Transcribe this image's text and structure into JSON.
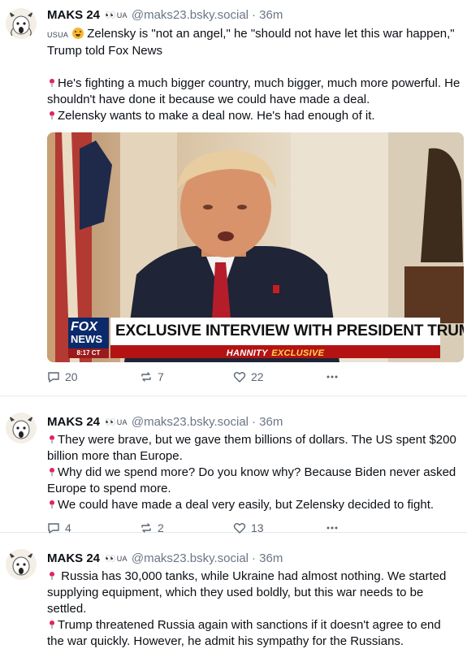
{
  "posts": [
    {
      "author": {
        "name": "MAKS 24",
        "flag_code": "UA",
        "handle": "@maks23.bsky.social",
        "time": "· 36m"
      },
      "lines": [
        {
          "prefix_code": "USUA",
          "emoji": "😳",
          "text": "Zelensky is \"not an angel,\" he \"should not have let this war happen,\" Trump told Fox News"
        },
        {
          "text": ""
        },
        {
          "pin": true,
          "text": "He's fighting a much bigger country, much bigger, much more powerful. He shouldn't have done it because we could have made a deal."
        },
        {
          "pin": true,
          "text": "Zelensky wants to make a deal now. He's had enough of it."
        }
      ],
      "media": {
        "banner": "EXCLUSIVE INTERVIEW WITH PRESIDENT TRUMP",
        "subtitle": "HANNITY",
        "subtitle_highlight": "EXCLUSIVE",
        "logo_top": "FOX",
        "logo_bottom": "NEWS",
        "logo_time": "8:17 CT"
      },
      "stats": {
        "replies": "20",
        "reposts": "7",
        "likes": "22"
      }
    },
    {
      "author": {
        "name": "MAKS 24",
        "flag_code": "UA",
        "handle": "@maks23.bsky.social",
        "time": "· 36m"
      },
      "lines": [
        {
          "pin": true,
          "text": "They were brave, but we gave them billions of dollars. The US spent $200 billion more than Europe."
        },
        {
          "pin": true,
          "text": "Why did we spend more? Do you know why? Because Biden never asked Europe to spend more."
        },
        {
          "pin": true,
          "text": "We could have made a deal very easily, but Zelensky decided to fight."
        }
      ],
      "stats": {
        "replies": "4",
        "reposts": "2",
        "likes": "13"
      }
    },
    {
      "author": {
        "name": "MAKS 24",
        "flag_code": "UA",
        "handle": "@maks23.bsky.social",
        "time": "· 36m"
      },
      "lines": [
        {
          "pin": true,
          "text": " Russia has 30,000 tanks, while Ukraine had almost nothing. We started supplying equipment, which they used boldly, but this war needs to be settled."
        },
        {
          "pin": true,
          "text": "Trump threatened Russia again with sanctions if it doesn't agree to end the war quickly. However, he admit his sympathy for the Russians."
        }
      ]
    }
  ]
}
